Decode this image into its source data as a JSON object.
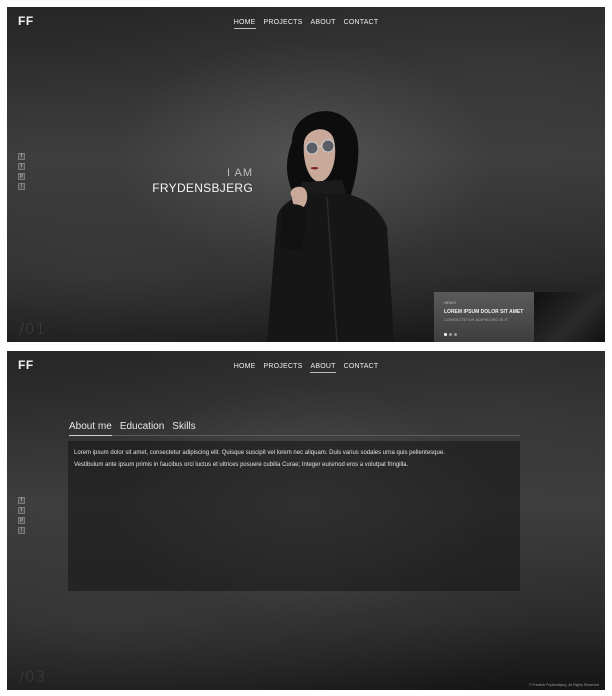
{
  "brand": {
    "logo": "FF"
  },
  "nav": {
    "home": "HOME",
    "projects": "PROJECTS",
    "about": "ABOUT",
    "contact": "CONTACT"
  },
  "social_icons": [
    "facebook-icon",
    "twitter-icon",
    "pinterest-icon",
    "instagram-icon"
  ],
  "hero": {
    "intro_small": "I AM",
    "intro_big": "FRYDENSBJERG",
    "page_number": "/01",
    "slide": {
      "tag": "NEWS",
      "title": "LOREM IPSUM DOLOR SIT AMET",
      "subtitle": "CONSECTETUR ADIPISCING ELIT"
    }
  },
  "about": {
    "tabs": [
      "About me",
      "Education",
      "Skills"
    ],
    "active_tab": "About me",
    "text_line_1": "Lorem ipsum dolor sit amet, consectetur adipiscing elit. Quisque suscipit vel lorem nec aliquam. Duis varius sodales urna quis pellentesque.",
    "text_line_2": "Vestibulum ante ipsum primis in faucibus orci luctus et ultrices posuere cubilia Curae; Integer euismod eros a volutpat fringilla.",
    "page_number": "/03",
    "footer": "© Frederik Frydensbjerg. All Rights Reserved"
  }
}
